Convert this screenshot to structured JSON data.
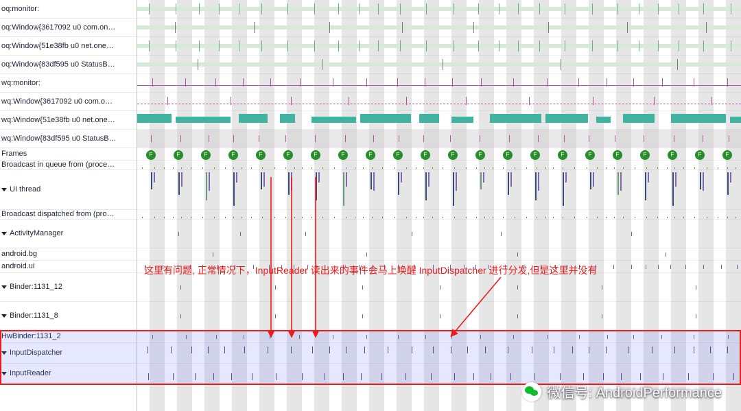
{
  "rows": [
    {
      "label": "oq:monitor:",
      "expand": false
    },
    {
      "label": "oq:Window{3617092 u0 com.on…",
      "expand": false
    },
    {
      "label": "oq:Window{51e38fb u0 net.one…",
      "expand": false
    },
    {
      "label": "oq:Window{83df595 u0 StatusB…",
      "expand": false
    },
    {
      "label": "wq:monitor:",
      "expand": false
    },
    {
      "label": "wq:Window{3617092 u0 com.o…",
      "expand": false
    },
    {
      "label": "wq:Window{51e38fb u0 net.one…",
      "expand": false
    },
    {
      "label": "wq:Window{83df595 u0 StatusB…",
      "expand": false
    },
    {
      "label": "Frames",
      "expand": false
    },
    {
      "label": "Broadcast in queue from (proce…",
      "expand": false
    },
    {
      "label": "UI thread",
      "expand": true
    },
    {
      "label": "Broadcast dispatched from (pro…",
      "expand": false
    },
    {
      "label": "ActivityManager",
      "expand": true
    },
    {
      "label": "android.bg",
      "expand": false
    },
    {
      "label": "android.ui",
      "expand": false
    },
    {
      "label": "Binder:1131_12",
      "expand": true
    },
    {
      "label": "Binder:1131_8",
      "expand": true
    },
    {
      "label": "HwBinder:1131_2",
      "expand": false
    },
    {
      "label": "InputDispatcher",
      "expand": true
    },
    {
      "label": "InputReader",
      "expand": true
    }
  ],
  "frame_marker": "F",
  "annotation": "这里有问题, 正常情况下，InputReader 读出来的事件会马上唤醒 InputDispatcher 进行分发,但是这里并没有",
  "watermark": "微信号: AndroidPerformance",
  "colors": {
    "accent_red": "#ee1b1b",
    "teal": "#41b3a3",
    "purple": "#b44fa3"
  }
}
